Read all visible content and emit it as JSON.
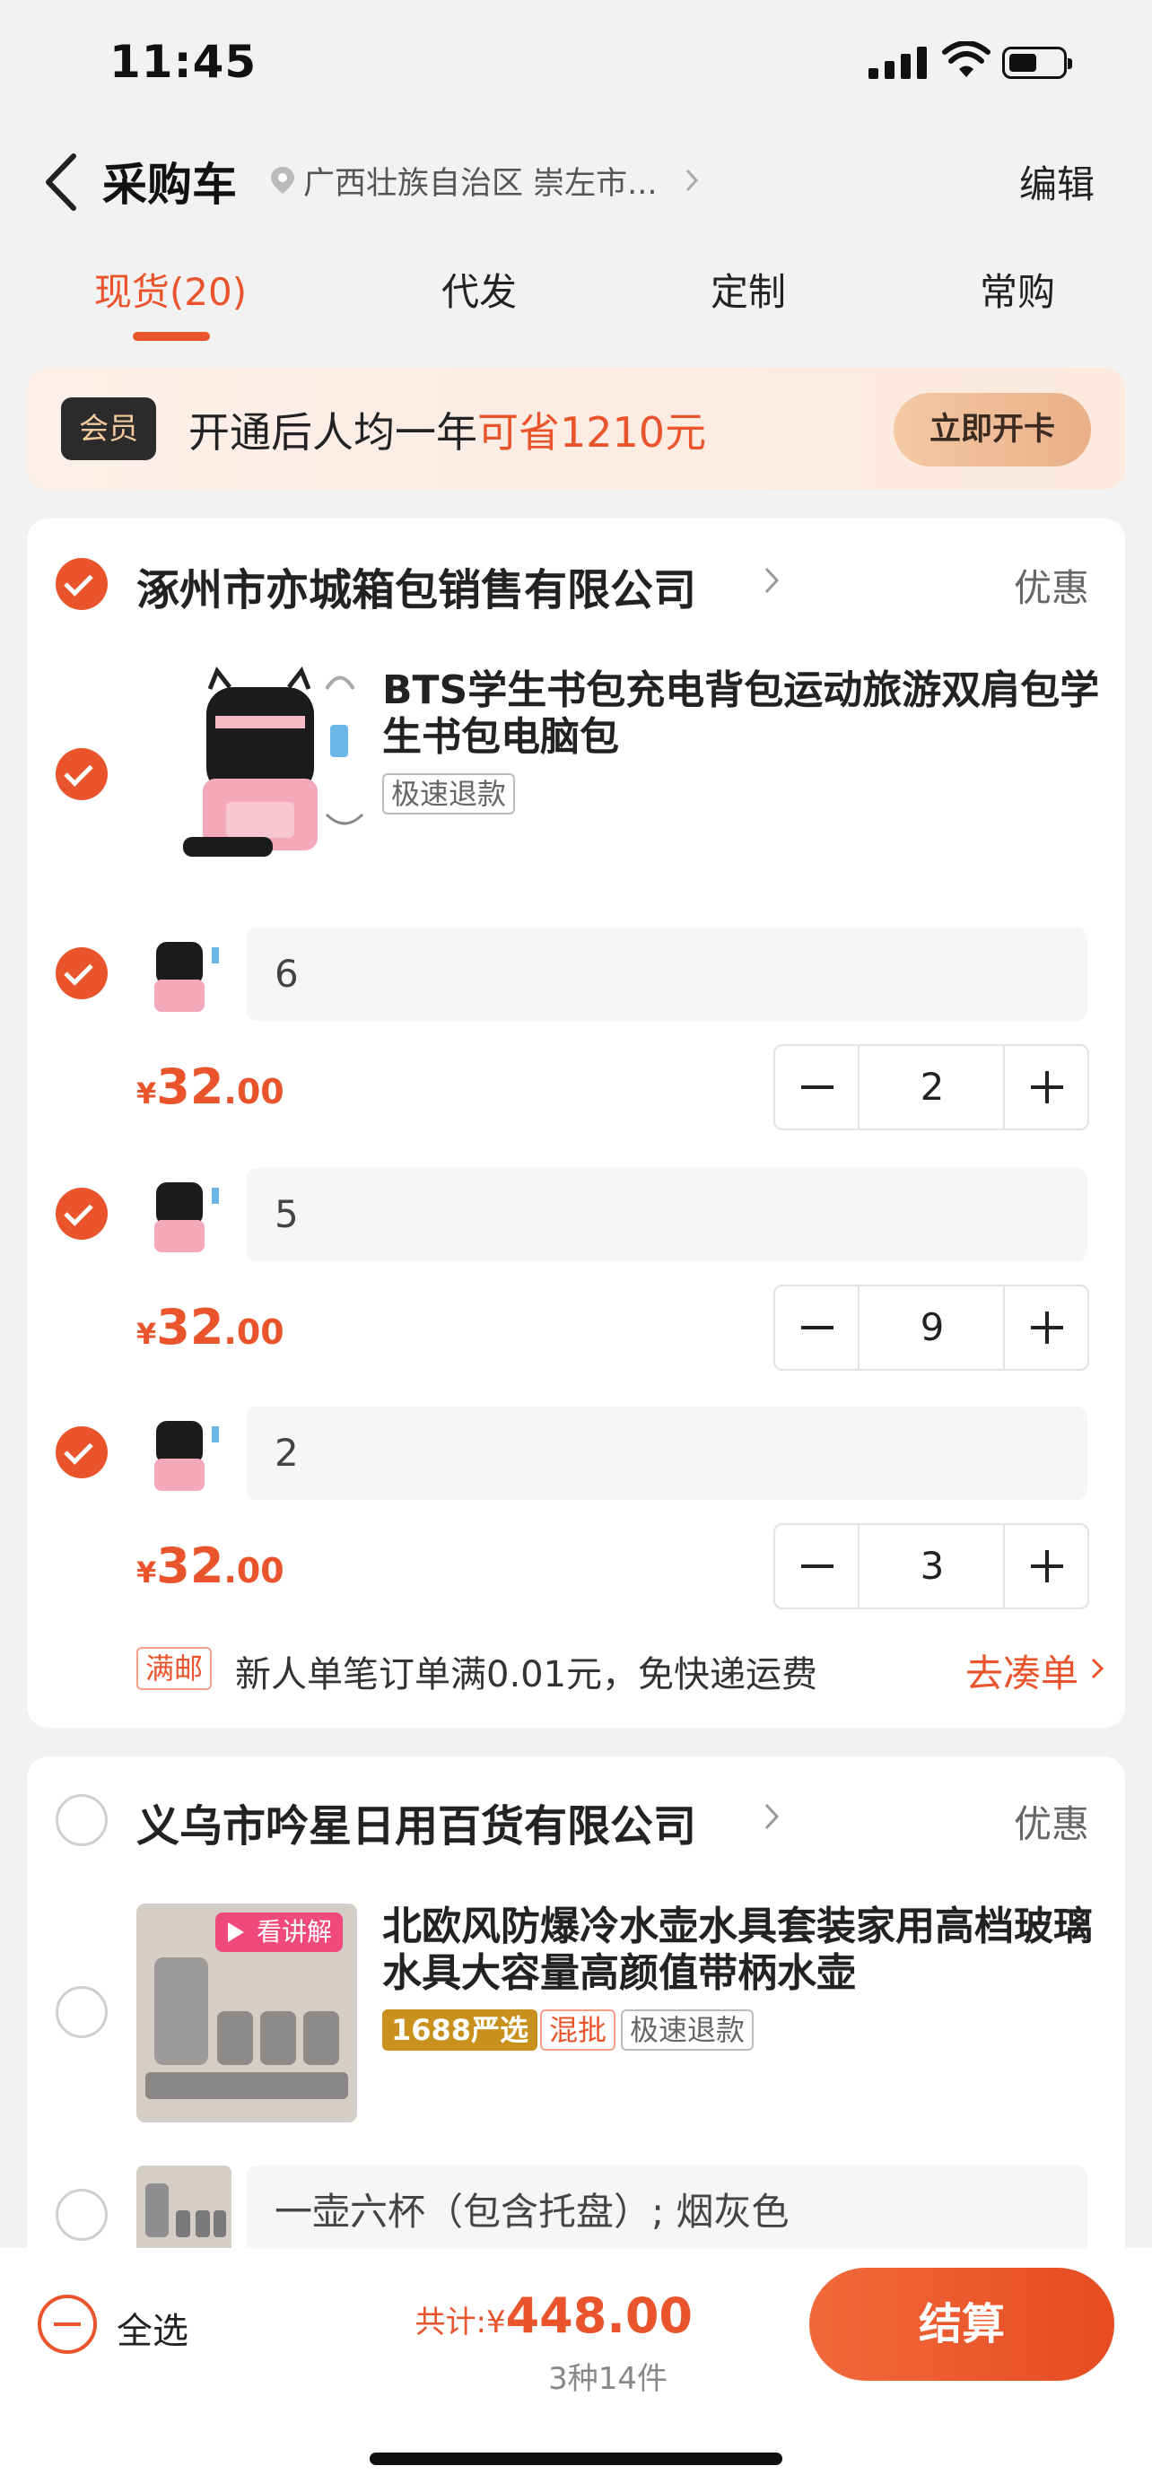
{
  "status_bar": {
    "time": "11:45"
  },
  "nav": {
    "title": "采购车",
    "location": "广西壮族自治区 崇左市...",
    "edit_label": "编辑"
  },
  "tabs": [
    {
      "label": "现货(20)",
      "active": true
    },
    {
      "label": "代发",
      "active": false
    },
    {
      "label": "定制",
      "active": false
    },
    {
      "label": "常购",
      "active": false
    }
  ],
  "member_banner": {
    "badge": "会员",
    "text_prefix": "开通后人均一年",
    "text_highlight": "可省1210元",
    "button_label": "立即开卡"
  },
  "shops": [
    {
      "name": "涿州市亦城箱包销售有限公司",
      "promo_label": "优惠",
      "selected": true,
      "product": {
        "title": "BTS学生书包充电背包运动旅游双肩包学生书包电脑包",
        "tags": [
          "极速退款"
        ]
      },
      "skus": [
        {
          "spec": "6",
          "price_currency": "¥",
          "price_int": "32",
          "price_dec": ".00",
          "quantity": "2",
          "selected": true
        },
        {
          "spec": "5",
          "price_currency": "¥",
          "price_int": "32",
          "price_dec": ".00",
          "quantity": "9",
          "selected": true
        },
        {
          "spec": "2",
          "price_currency": "¥",
          "price_int": "32",
          "price_dec": ".00",
          "quantity": "3",
          "selected": true
        }
      ],
      "shipping": {
        "tag": "满邮",
        "text": "新人单笔订单满0.01元，免快递运费",
        "link_label": "去凑单"
      }
    },
    {
      "name": "义乌市吟星日用百货有限公司",
      "promo_label": "优惠",
      "selected": false,
      "product": {
        "title": "北欧风防爆冷水壶水具套装家用高档玻璃水具大容量高颜值带柄水壶",
        "image_badge": "看讲解",
        "tags": [
          "1688严选",
          "混批",
          "极速退款"
        ]
      },
      "skus": [
        {
          "spec": "一壶六杯（包含托盘）; 烟灰色",
          "selected": false
        }
      ]
    }
  ],
  "bottom_bar": {
    "select_all_label": "全选",
    "total_prefix": "共计:",
    "total_currency": "¥",
    "total_amount": "448.00",
    "total_sub": "3种14件",
    "checkout_label": "结算"
  },
  "colors": {
    "accent": "#e9542c",
    "gold_tag": "#c8901c"
  }
}
